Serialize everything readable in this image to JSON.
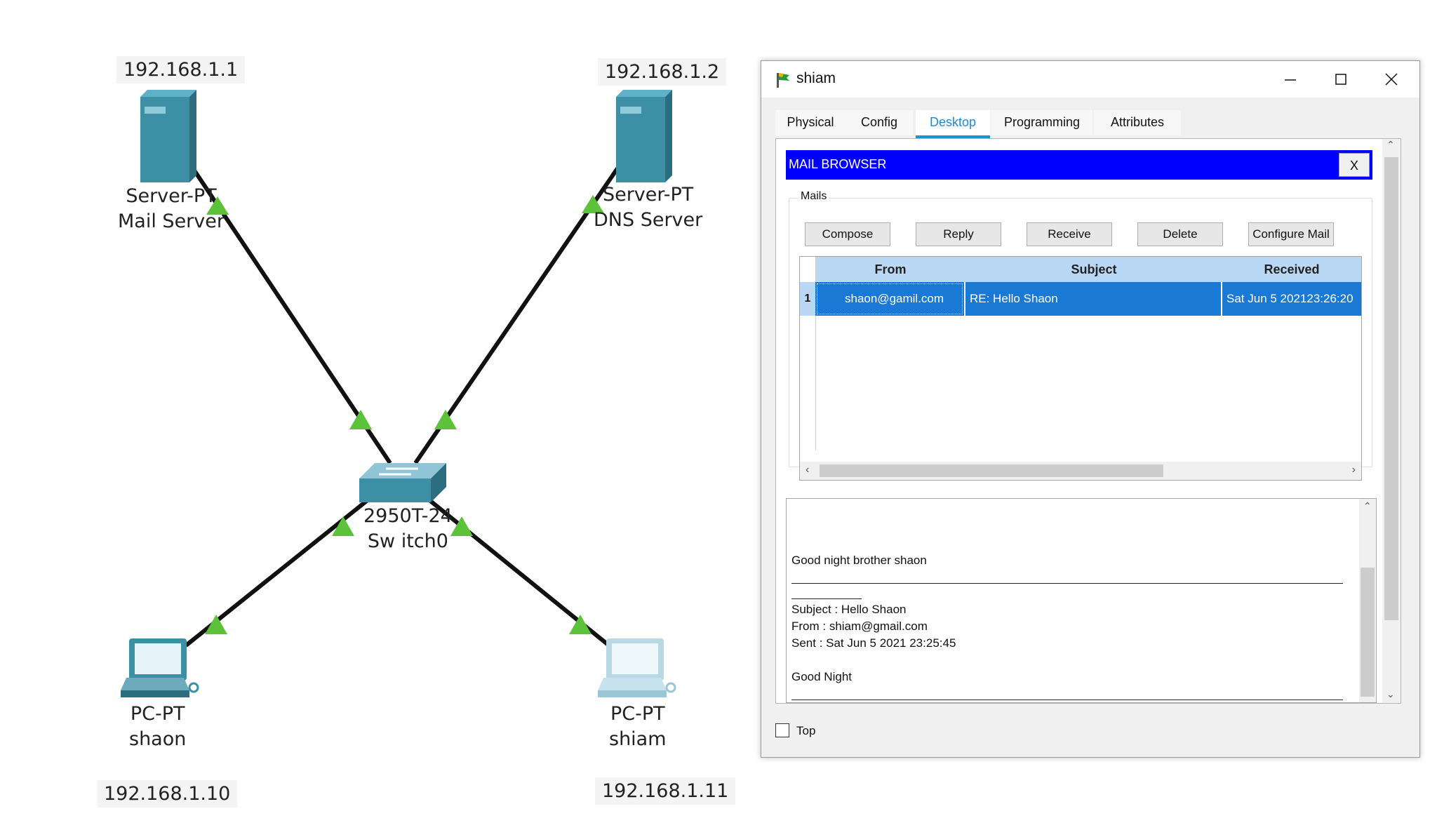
{
  "topology": {
    "ips": {
      "mail_server": "192.168.1.1",
      "dns_server": "192.168.1.2",
      "pc_shaon": "192.168.1.10",
      "pc_shiam": "192.168.1.11"
    },
    "devices": {
      "mail_server": {
        "type": "Server-PT",
        "name": "Mail Server"
      },
      "dns_server": {
        "type": "Server-PT",
        "name": "DNS Server"
      },
      "switch": {
        "type": "2950T-24",
        "name": "Sw itch0"
      },
      "pc_shaon": {
        "type": "PC-PT",
        "name": "shaon"
      },
      "pc_shiam": {
        "type": "PC-PT",
        "name": "shiam"
      }
    },
    "link_color": "#111111",
    "link_status_color": "#5cc23a",
    "device_color": "#3d8fa5"
  },
  "window": {
    "title": "shiam",
    "tabs": [
      "Physical",
      "Config",
      "Desktop",
      "Programming",
      "Attributes"
    ],
    "active_tab": "Desktop",
    "accent": "#1e90d8"
  },
  "mail_browser": {
    "title": "MAIL BROWSER",
    "close_label": "X",
    "header_color": "#0000ff",
    "group_label": "Mails",
    "buttons": {
      "compose": "Compose",
      "reply": "Reply",
      "receive": "Receive",
      "delete": "Delete",
      "configure": "Configure Mail"
    },
    "columns": {
      "from": "From",
      "subject": "Subject",
      "received": "Received"
    },
    "rows": [
      {
        "num": "1",
        "from": "shaon@gamil.com",
        "subject": "RE: Hello Shaon",
        "received": "Sat Jun 5 202123:26:20"
      }
    ],
    "selection_color": "#1a79d4",
    "body": {
      "line1": "Good night brother shaon",
      "subject": "Subject : Hello Shaon",
      "from": "From : shiam@gmail.com",
      "sent": "Sent : Sat Jun 5 2021 23:25:45",
      "message": "Good Night"
    }
  },
  "footer": {
    "top_label": "Top",
    "top_checked": false
  }
}
